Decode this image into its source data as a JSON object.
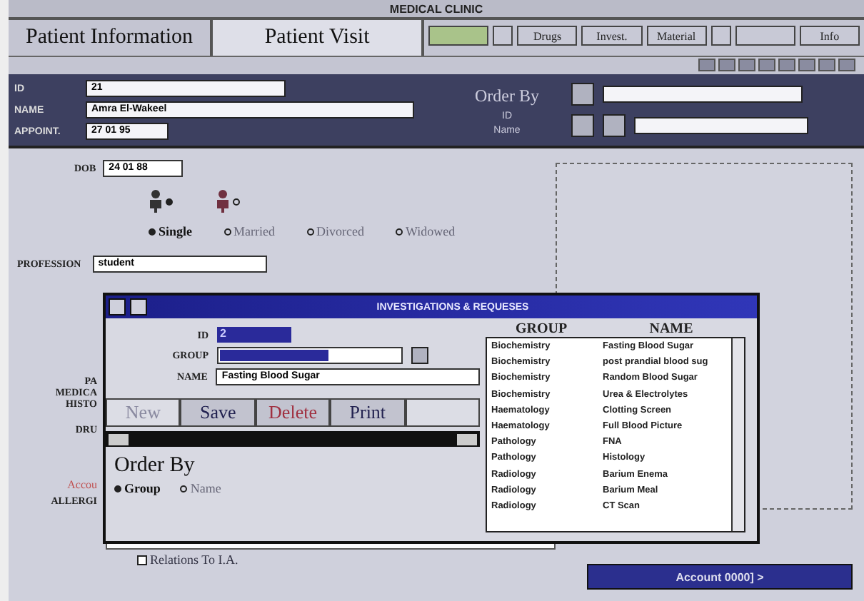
{
  "window": {
    "title": "MEDICAL CLINIC"
  },
  "tabs": [
    {
      "label": "Patient Information",
      "selected": false
    },
    {
      "label": "Patient Visit",
      "selected": true
    }
  ],
  "toolbar_buttons": [
    {
      "kind": "highlight"
    },
    {
      "kind": "icon"
    },
    {
      "kind": "text",
      "label": "Drugs"
    },
    {
      "kind": "text",
      "label": "Invest."
    },
    {
      "kind": "text",
      "label": "Material"
    },
    {
      "kind": "icon"
    },
    {
      "kind": "blank"
    },
    {
      "kind": "text",
      "label": "Info"
    }
  ],
  "header": {
    "fields": [
      {
        "label": "ID",
        "value": "21"
      },
      {
        "label": "NAME",
        "value": "Amra El-Wakeel"
      },
      {
        "label": "APPOINT.",
        "value": "27 01 95"
      }
    ],
    "order_by": {
      "title": "Order By",
      "options": [
        "ID",
        "Name"
      ]
    }
  },
  "patient": {
    "dob": {
      "label": "DOB",
      "value": "24 01 88"
    },
    "gender": [
      {
        "kind": "male",
        "selected": true
      },
      {
        "kind": "female",
        "selected": false
      }
    ],
    "marital": [
      {
        "label": "Single",
        "selected": true
      },
      {
        "label": "Married",
        "selected": false
      },
      {
        "label": "Divorced",
        "selected": false
      },
      {
        "label": "Widowed",
        "selected": false
      }
    ],
    "profession": {
      "label": "PROFESSION",
      "value": "student"
    },
    "side_labels": [
      "PA",
      "MEDICA",
      "HISTO",
      "DRU"
    ],
    "account_label": "Accou",
    "allergy_label": "ALLERGI",
    "relations": {
      "label": "Relations To I.A.",
      "checked": false
    },
    "account_button": "Account 0000] >"
  },
  "dialog": {
    "title": "INVESTIGATIONS & REQUESES",
    "id": {
      "label": "ID",
      "value": "2"
    },
    "group": {
      "label": "GROUP"
    },
    "name": {
      "label": "NAME",
      "value": "Fasting Blood Sugar"
    },
    "buttons": [
      {
        "label": "New",
        "kind": "normal",
        "disabled": true
      },
      {
        "label": "Save",
        "kind": "normal",
        "disabled": false
      },
      {
        "label": "Delete",
        "kind": "danger",
        "disabled": false
      },
      {
        "label": "Print",
        "kind": "normal",
        "disabled": false
      },
      {
        "kind": "normal",
        "disabled": true
      }
    ],
    "order_by": {
      "title": "Order By",
      "options": [
        {
          "label": "Group",
          "selected": true
        },
        {
          "label": "Name",
          "selected": false
        }
      ]
    },
    "list": {
      "columns": [
        "GROUP",
        "NAME"
      ],
      "rows": [
        [
          "Biochemistry",
          "Fasting Blood Sugar"
        ],
        [
          "Biochemistry",
          "post prandial blood sug"
        ],
        [
          "Biochemistry",
          "Random Blood Sugar"
        ],
        [
          "Biochemistry",
          "Urea & Electrolytes"
        ],
        [
          "Haematology",
          "Clotting Screen"
        ],
        [
          "Haematology",
          "Full Blood Picture"
        ],
        [
          "Pathology",
          "FNA"
        ],
        [
          "Pathology",
          "Histology"
        ],
        [
          "Radiology",
          "Barium Enema"
        ],
        [
          "Radiology",
          "Barium Meal"
        ],
        [
          "Radiology",
          "CT Scan"
        ]
      ]
    }
  }
}
